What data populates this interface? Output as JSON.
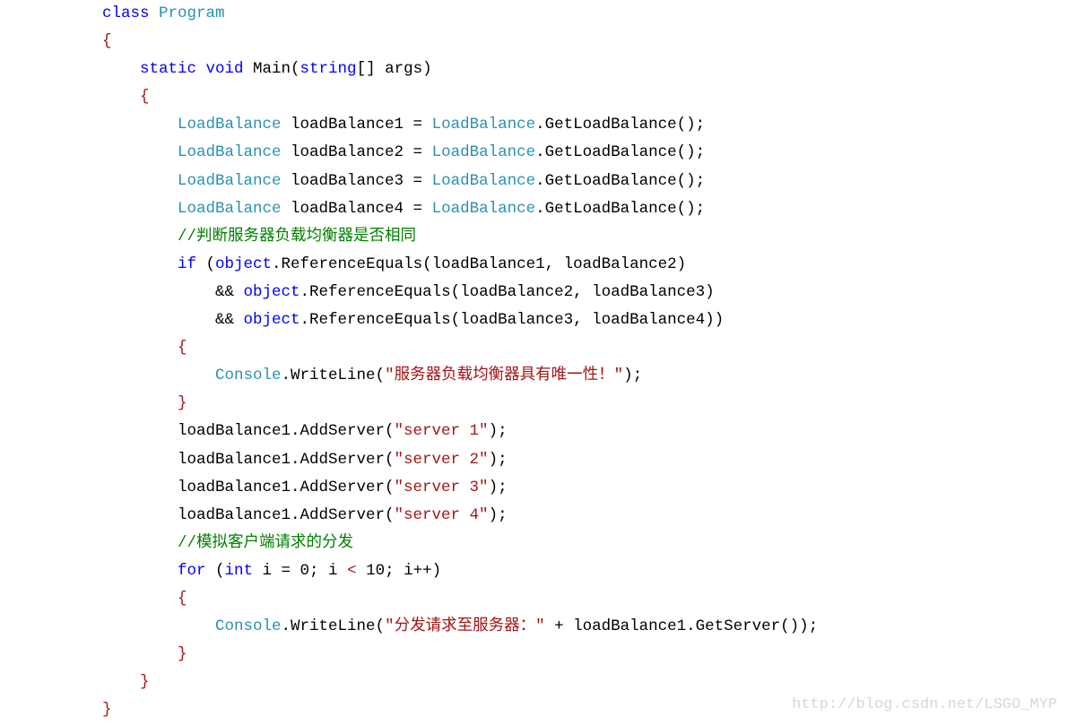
{
  "code": {
    "lines": [
      {
        "indent": 0,
        "tokens": [
          {
            "t": "class ",
            "c": "k"
          },
          {
            "t": "Program",
            "c": "t"
          }
        ]
      },
      {
        "indent": 0,
        "tokens": [
          {
            "t": "{",
            "c": "s"
          }
        ]
      },
      {
        "indent": 1,
        "tokens": [
          {
            "t": "static void ",
            "c": "k"
          },
          {
            "t": "Main(",
            "c": "p"
          },
          {
            "t": "string",
            "c": "k"
          },
          {
            "t": "[] args)",
            "c": "p"
          }
        ]
      },
      {
        "indent": 1,
        "tokens": [
          {
            "t": "{",
            "c": "s"
          }
        ]
      },
      {
        "indent": 2,
        "tokens": [
          {
            "t": "LoadBalance",
            "c": "t"
          },
          {
            "t": " loadBalance1 = ",
            "c": "p"
          },
          {
            "t": "LoadBalance",
            "c": "t"
          },
          {
            "t": ".GetLoadBalance();",
            "c": "p"
          }
        ]
      },
      {
        "indent": 2,
        "tokens": [
          {
            "t": "LoadBalance",
            "c": "t"
          },
          {
            "t": " loadBalance2 = ",
            "c": "p"
          },
          {
            "t": "LoadBalance",
            "c": "t"
          },
          {
            "t": ".GetLoadBalance();",
            "c": "p"
          }
        ]
      },
      {
        "indent": 2,
        "tokens": [
          {
            "t": "LoadBalance",
            "c": "t"
          },
          {
            "t": " loadBalance3 = ",
            "c": "p"
          },
          {
            "t": "LoadBalance",
            "c": "t"
          },
          {
            "t": ".GetLoadBalance();",
            "c": "p"
          }
        ]
      },
      {
        "indent": 2,
        "tokens": [
          {
            "t": "LoadBalance",
            "c": "t"
          },
          {
            "t": " loadBalance4 = ",
            "c": "p"
          },
          {
            "t": "LoadBalance",
            "c": "t"
          },
          {
            "t": ".GetLoadBalance();",
            "c": "p"
          }
        ]
      },
      {
        "indent": 2,
        "tokens": [
          {
            "t": "//判断服务器负载均衡器是否相同",
            "c": "c"
          }
        ]
      },
      {
        "indent": 2,
        "tokens": [
          {
            "t": "if",
            "c": "k"
          },
          {
            "t": " (",
            "c": "p"
          },
          {
            "t": "object",
            "c": "k"
          },
          {
            "t": ".ReferenceEquals(loadBalance1, loadBalance2)",
            "c": "p"
          }
        ]
      },
      {
        "indent": 3,
        "tokens": [
          {
            "t": "&& ",
            "c": "p"
          },
          {
            "t": "object",
            "c": "k"
          },
          {
            "t": ".ReferenceEquals(loadBalance2, loadBalance3)",
            "c": "p"
          }
        ]
      },
      {
        "indent": 3,
        "tokens": [
          {
            "t": "&& ",
            "c": "p"
          },
          {
            "t": "object",
            "c": "k"
          },
          {
            "t": ".ReferenceEquals(loadBalance3, loadBalance4))",
            "c": "p"
          }
        ]
      },
      {
        "indent": 2,
        "tokens": [
          {
            "t": "{",
            "c": "s"
          }
        ]
      },
      {
        "indent": 3,
        "tokens": [
          {
            "t": "Console",
            "c": "t"
          },
          {
            "t": ".WriteLine(",
            "c": "p"
          },
          {
            "t": "\"服务器负载均衡器具有唯一性！\"",
            "c": "s"
          },
          {
            "t": ");",
            "c": "p"
          }
        ]
      },
      {
        "indent": 2,
        "tokens": [
          {
            "t": "}",
            "c": "s"
          }
        ]
      },
      {
        "indent": 2,
        "tokens": [
          {
            "t": "loadBalance1.AddServer(",
            "c": "p"
          },
          {
            "t": "\"server 1\"",
            "c": "s"
          },
          {
            "t": ");",
            "c": "p"
          }
        ]
      },
      {
        "indent": 2,
        "tokens": [
          {
            "t": "loadBalance1.AddServer(",
            "c": "p"
          },
          {
            "t": "\"server 2\"",
            "c": "s"
          },
          {
            "t": ");",
            "c": "p"
          }
        ]
      },
      {
        "indent": 2,
        "tokens": [
          {
            "t": "loadBalance1.AddServer(",
            "c": "p"
          },
          {
            "t": "\"server 3\"",
            "c": "s"
          },
          {
            "t": ");",
            "c": "p"
          }
        ]
      },
      {
        "indent": 2,
        "tokens": [
          {
            "t": "loadBalance1.AddServer(",
            "c": "p"
          },
          {
            "t": "\"server 4\"",
            "c": "s"
          },
          {
            "t": ");",
            "c": "p"
          }
        ]
      },
      {
        "indent": 2,
        "tokens": [
          {
            "t": "//模拟客户端请求的分发",
            "c": "c"
          }
        ]
      },
      {
        "indent": 2,
        "tokens": [
          {
            "t": "for",
            "c": "k"
          },
          {
            "t": " (",
            "c": "p"
          },
          {
            "t": "int",
            "c": "k"
          },
          {
            "t": " i = 0; i ",
            "c": "p"
          },
          {
            "t": "<",
            "c": "s"
          },
          {
            "t": " 10; i++)",
            "c": "p"
          }
        ]
      },
      {
        "indent": 2,
        "tokens": [
          {
            "t": "{",
            "c": "s"
          }
        ]
      },
      {
        "indent": 3,
        "tokens": [
          {
            "t": "Console",
            "c": "t"
          },
          {
            "t": ".WriteLine(",
            "c": "p"
          },
          {
            "t": "\"分发请求至服务器：\"",
            "c": "s"
          },
          {
            "t": " + loadBalance1.GetServer());",
            "c": "p"
          }
        ]
      },
      {
        "indent": 2,
        "tokens": [
          {
            "t": "}",
            "c": "s"
          }
        ]
      },
      {
        "indent": 1,
        "tokens": [
          {
            "t": "}",
            "c": "s"
          }
        ]
      },
      {
        "indent": 0,
        "tokens": [
          {
            "t": "}",
            "c": "s"
          }
        ]
      }
    ]
  },
  "watermark": "http://blog.csdn.net/LSGO_MYP",
  "colors": {
    "keyword": "#0000ff",
    "type": "#2b91af",
    "string": "#a31515",
    "comment": "#008000",
    "text": "#000000"
  }
}
